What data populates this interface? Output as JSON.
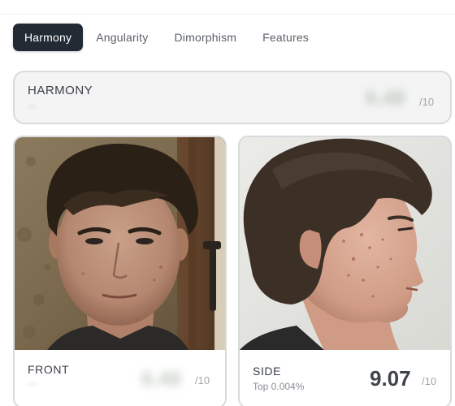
{
  "tabs": [
    {
      "label": "Harmony",
      "active": true
    },
    {
      "label": "Angularity",
      "active": false
    },
    {
      "label": "Dimorphism",
      "active": false
    },
    {
      "label": "Features",
      "active": false
    }
  ],
  "harmony": {
    "title": "HARMONY",
    "score_blurred": "6.48",
    "percentile_blurred": "—",
    "out_of": "/10"
  },
  "front": {
    "title": "FRONT",
    "score_blurred": "6.48",
    "percentile_blurred": "—",
    "out_of": "/10"
  },
  "side": {
    "title": "SIDE",
    "rank": "Top 0.004%",
    "score": "9.07",
    "out_of": "/10"
  },
  "colors": {
    "active_tab_bg": "#222a33",
    "card_border": "#d9dadd"
  }
}
